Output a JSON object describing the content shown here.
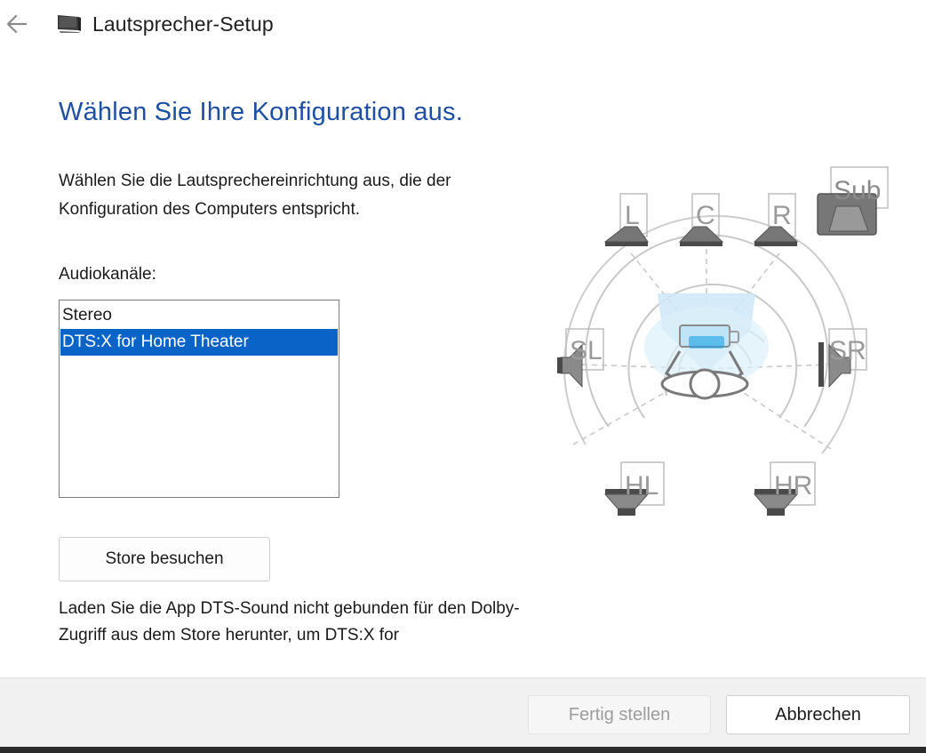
{
  "window": {
    "title": "Lautsprecher-Setup",
    "back_icon": "arrow-left-icon",
    "app_icon": "monitor-speaker-icon"
  },
  "main": {
    "heading": "Wählen Sie Ihre Konfiguration aus.",
    "description": "Wählen Sie die Lautsprechereinrichtung aus, die der Konfiguration des Computers entspricht.",
    "list_label": "Audiokanäle:",
    "channels": [
      {
        "label": "Stereo",
        "selected": false
      },
      {
        "label": "DTS:X for Home Theater",
        "selected": true
      }
    ],
    "store_button": "Store besuchen",
    "store_info": "Laden Sie die App DTS-Sound nicht gebunden für den Dolby-Zugriff aus dem Store herunter, um DTS:X for"
  },
  "diagram": {
    "speakers": {
      "front_left": "L",
      "center": "C",
      "front_right": "R",
      "subwoofer": "Sub",
      "side_left": "SL",
      "side_right": "SR",
      "height_left": "HL",
      "height_right": "HR"
    }
  },
  "footer": {
    "finish_button": "Fertig stellen",
    "cancel_button": "Abbrechen"
  },
  "colors": {
    "heading": "#1f4fa3",
    "selection": "#0a64c8",
    "footer_bg": "#f1f1f1"
  }
}
